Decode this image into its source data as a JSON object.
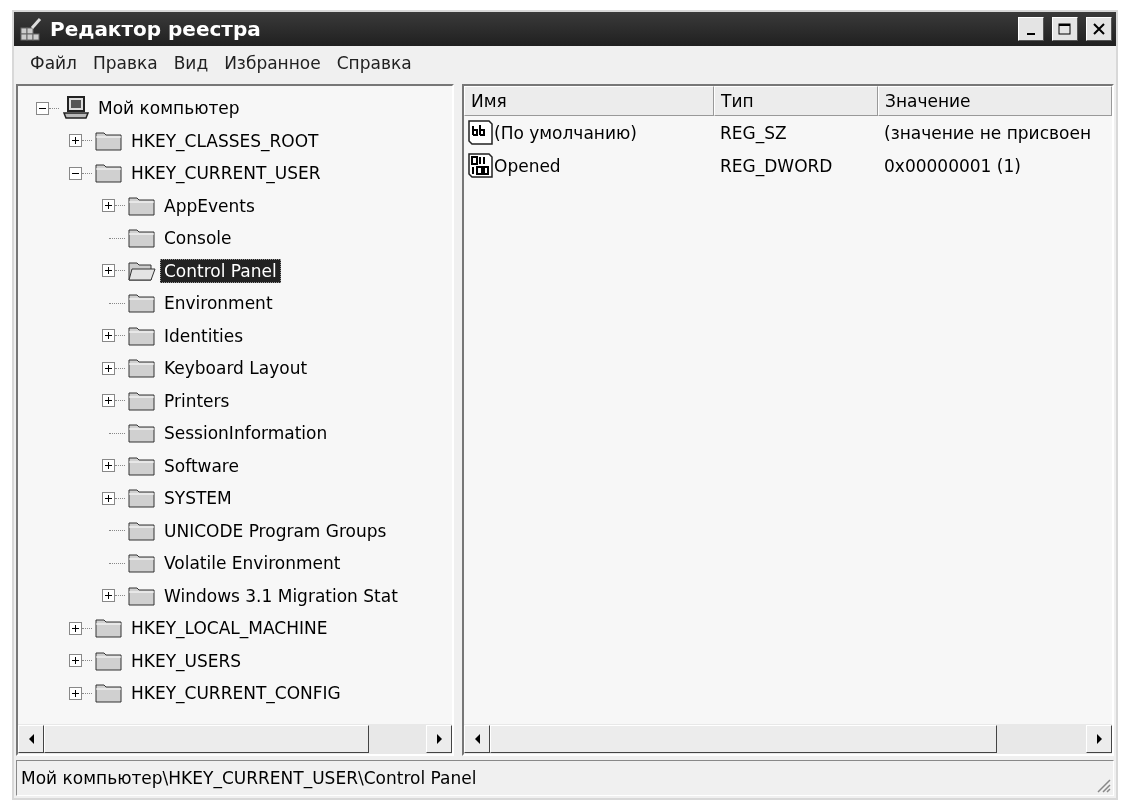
{
  "window": {
    "title": "Редактор реестра"
  },
  "menu": [
    "Файл",
    "Правка",
    "Вид",
    "Избранное",
    "Справка"
  ],
  "tree": [
    {
      "label": "Мой компьютер",
      "kind": "computer",
      "has_children": true,
      "expanded": true,
      "selected": false,
      "children": [
        {
          "label": "HKEY_CLASSES_ROOT",
          "kind": "folder",
          "has_children": true,
          "expanded": false,
          "selected": false
        },
        {
          "label": "HKEY_CURRENT_USER",
          "kind": "folder",
          "has_children": true,
          "expanded": true,
          "selected": false,
          "children": [
            {
              "label": "AppEvents",
              "kind": "folder",
              "has_children": true,
              "expanded": false,
              "selected": false
            },
            {
              "label": "Console",
              "kind": "folder",
              "has_children": false,
              "selected": false
            },
            {
              "label": "Control Panel",
              "kind": "folder",
              "has_children": true,
              "expanded": false,
              "selected": true
            },
            {
              "label": "Environment",
              "kind": "folder",
              "has_children": false,
              "selected": false
            },
            {
              "label": "Identities",
              "kind": "folder",
              "has_children": true,
              "expanded": false,
              "selected": false
            },
            {
              "label": "Keyboard Layout",
              "kind": "folder",
              "has_children": true,
              "expanded": false,
              "selected": false
            },
            {
              "label": "Printers",
              "kind": "folder",
              "has_children": true,
              "expanded": false,
              "selected": false
            },
            {
              "label": "SessionInformation",
              "kind": "folder",
              "has_children": false,
              "selected": false
            },
            {
              "label": "Software",
              "kind": "folder",
              "has_children": true,
              "expanded": false,
              "selected": false
            },
            {
              "label": "SYSTEM",
              "kind": "folder",
              "has_children": true,
              "expanded": false,
              "selected": false
            },
            {
              "label": "UNICODE Program Groups",
              "kind": "folder",
              "has_children": false,
              "selected": false
            },
            {
              "label": "Volatile Environment",
              "kind": "folder",
              "has_children": false,
              "selected": false
            },
            {
              "label": "Windows 3.1 Migration Stat",
              "kind": "folder",
              "has_children": true,
              "expanded": false,
              "selected": false
            }
          ]
        },
        {
          "label": "HKEY_LOCAL_MACHINE",
          "kind": "folder",
          "has_children": true,
          "expanded": false,
          "selected": false
        },
        {
          "label": "HKEY_USERS",
          "kind": "folder",
          "has_children": true,
          "expanded": false,
          "selected": false
        },
        {
          "label": "HKEY_CURRENT_CONFIG",
          "kind": "folder",
          "has_children": true,
          "expanded": false,
          "selected": false
        }
      ]
    }
  ],
  "values": {
    "columns": [
      "Имя",
      "Тип",
      "Значение"
    ],
    "rows": [
      {
        "kind": "string",
        "name": "(По умолчанию)",
        "type": "REG_SZ",
        "data": "(значение не присвоен"
      },
      {
        "kind": "binary",
        "name": "Opened",
        "type": "REG_DWORD",
        "data": "0x00000001 (1)"
      }
    ]
  },
  "status_bar": "Мой компьютер\\HKEY_CURRENT_USER\\Control Panel"
}
